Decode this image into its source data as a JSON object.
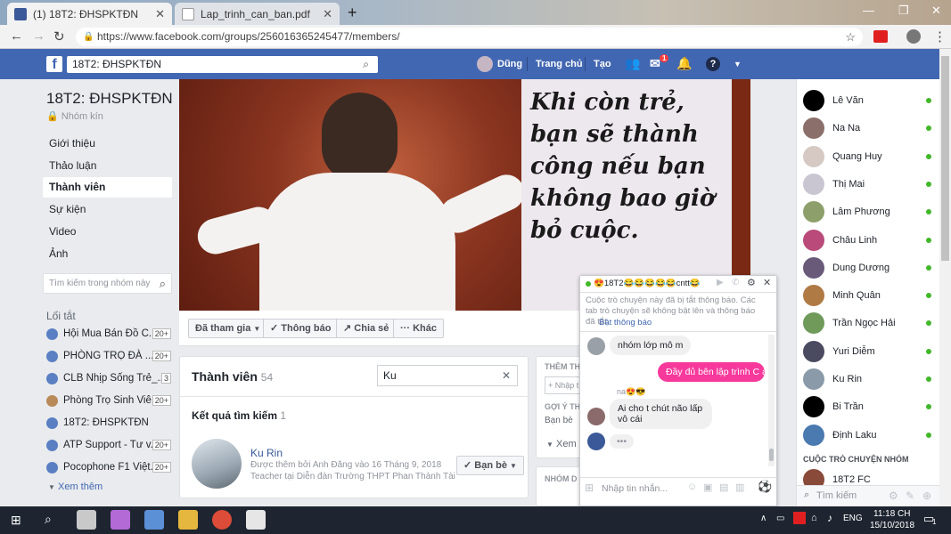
{
  "browser": {
    "tabs": [
      {
        "title": "(1) 18T2: ĐHSPKTĐN"
      },
      {
        "title": "Lap_trinh_can_ban.pdf"
      }
    ],
    "url": "https://www.facebook.com/groups/256016365245477/members/"
  },
  "fbbar": {
    "search_value": "18T2: ĐHSPKTĐN",
    "user": "Dũng",
    "home": "Trang chủ",
    "create": "Tạo",
    "messages_badge": "1"
  },
  "group": {
    "name": "18T2: ĐHSPKTĐN",
    "privacy": "Nhóm kín",
    "nav": [
      "Giới thiệu",
      "Thảo luận",
      "Thành viên",
      "Sự kiện",
      "Video",
      "Ảnh"
    ],
    "search_placeholder": "Tìm kiếm trong nhóm này",
    "shortcuts_title": "Lối tắt",
    "shortcuts": [
      {
        "label": "Hội Mua Bán Đồ C...",
        "count": "20+"
      },
      {
        "label": "PHÒNG TRỌ ĐÀ ...",
        "count": "20+"
      },
      {
        "label": "CLB Nhịp Sống Trẻ_...",
        "count": "3"
      },
      {
        "label": "Phòng Trọ Sinh Viê...",
        "count": "20+"
      },
      {
        "label": "18T2: ĐHSPKTĐN",
        "count": ""
      },
      {
        "label": "ATP Support - Tư v...",
        "count": "20+"
      },
      {
        "label": "Pocophone F1 Việt...",
        "count": "20+"
      }
    ],
    "see_more": "Xem thêm"
  },
  "cover": {
    "quote": "Khi còn trẻ, bạn sẽ thành công nếu bạn không bao giờ bỏ cuộc.",
    "joined": "Đã tham gia",
    "notify": "Thông báo",
    "share": "Chia sẻ",
    "more": "Khác"
  },
  "members": {
    "title": "Thành viên",
    "count": "54",
    "search_value": "Ku",
    "results_title": "Kết quả tìm kiếm",
    "results_count": "1",
    "result": {
      "name": "Ku Rin",
      "added": "Được thêm bởi Anh Đăng vào 16 Tháng 9, 2018",
      "work": "Teacher tại Diễn đàn Trường THPT Phan Thành Tài",
      "friend_button": "Bạn bè"
    }
  },
  "side_mid": {
    "add_title": "THÊM TH",
    "add_input": "+ Nhập t",
    "suggest_title": "GỢI Ý TH",
    "suggest_sub": "Bạn bè",
    "see": "Xem",
    "group_title": "NHÓM D"
  },
  "contacts": [
    {
      "name": "Lê Văn",
      "color": "#000000"
    },
    {
      "name": "Na Na",
      "color": "#8a6f6a"
    },
    {
      "name": "Quang Huy",
      "color": "#d6c9c4"
    },
    {
      "name": "Thị Mai",
      "color": "#c9c6d2"
    },
    {
      "name": "Lâm Phương",
      "color": "#8da06b"
    },
    {
      "name": "Châu Linh",
      "color": "#b94a7a"
    },
    {
      "name": "Dung Dương",
      "color": "#6a5a7a"
    },
    {
      "name": "Minh Quân",
      "color": "#b07a45"
    },
    {
      "name": "Trần Ngọc Hải",
      "color": "#6f9a5a"
    },
    {
      "name": "Yuri Diễm",
      "color": "#4a4a60"
    },
    {
      "name": "Ku Rin",
      "color": "#8a9aa8"
    },
    {
      "name": "Bi Trần",
      "color": "#000000"
    },
    {
      "name": "Định Laku",
      "color": "#4a7ab0"
    }
  ],
  "group_chats_title": "CUỘC TRÒ CHUYỆN NHÓM",
  "group_chat": {
    "name": "18T2 FC"
  },
  "contact_search": "Tìm kiếm",
  "chat": {
    "title": "😍18T2😂😂😂😂😂cntt😂",
    "notice": "Cuộc trò chuyện này đã bị tắt thông báo. Các tab trò chuyện sẽ không bật lên và thông báo đã tắt.",
    "notice_link": "Bật thông báo",
    "messages": [
      {
        "text": "nhóm lớp mô m",
        "side": "left"
      },
      {
        "text": "Đầy đủ bên lập trình C á",
        "side": "right"
      },
      {
        "text": "na😍😎",
        "side": "name"
      },
      {
        "text": "Ai cho t chút não lấp vô cái",
        "side": "left"
      },
      {
        "text": "•••",
        "side": "typing"
      }
    ],
    "input_placeholder": "Nhập tin nhắn..."
  },
  "taskbar": {
    "time": "11:18 CH",
    "date": "15/10/2018",
    "lang": "ENG",
    "notif": "1"
  }
}
